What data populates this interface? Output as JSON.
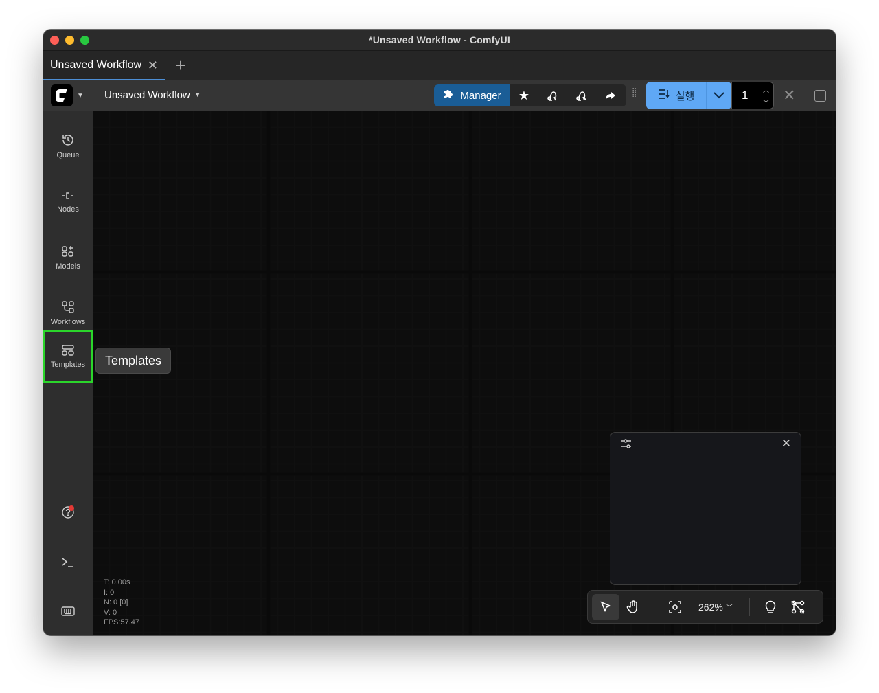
{
  "window": {
    "title": "*Unsaved Workflow - ComfyUI"
  },
  "tabs": [
    {
      "label": "Unsaved Workflow",
      "close_icon": "close-icon"
    }
  ],
  "tab_add_icon": "plus-icon",
  "toolbar": {
    "workflow_name": "Unsaved Workflow",
    "manager_label": "Manager",
    "run_label": "실행",
    "batch_count": "1"
  },
  "sidebar": {
    "items": [
      {
        "label": "Queue",
        "icon": "history-icon"
      },
      {
        "label": "Nodes",
        "icon": "node-icon"
      },
      {
        "label": "Models",
        "icon": "models-icon"
      },
      {
        "label": "Workflows",
        "icon": "workflows-icon"
      },
      {
        "label": "Templates",
        "icon": "templates-icon"
      }
    ],
    "bottom": [
      "help-icon",
      "terminal-icon",
      "keyboard-icon"
    ]
  },
  "tooltip": "Templates",
  "stats": {
    "t": "T: 0.00s",
    "i": "I: 0",
    "n": "N: 0 [0]",
    "v": "V: 0",
    "fps": "FPS:57.47"
  },
  "canvas_controls": {
    "zoom": "262%"
  },
  "colors": {
    "accent": "#5fa8f5",
    "manager": "#1a5d96",
    "active_outline": "#2bd62b",
    "notification": "#e53935"
  }
}
